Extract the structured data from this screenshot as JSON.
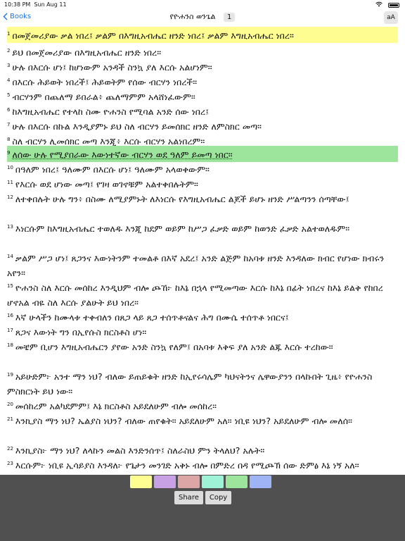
{
  "status_bar": {
    "time": "10:38 PM",
    "date": "Sun Aug 11",
    "battery_percent": 100
  },
  "nav": {
    "back_label": "Books",
    "title": "የዮሐንስ ወንጌል",
    "chapter": "1",
    "font_button": "aA"
  },
  "colors": {
    "accent": "#1a73e8",
    "highlight_yellow": "#fefd92",
    "highlight_green": "#9de59d"
  },
  "verses": [
    {
      "num": "1",
      "text": "በመጀመሪያው ቃል ነበረ፤ ቃልም በእግዚአብሔር ዘንድ ነበረ፤ ቃልም እግዚአብሔር ነበረ።",
      "highlight": "yellow"
    },
    {
      "num": "2",
      "text": "ይህ በመጀመሪያው በእግዚአብሔር ዘንድ ነበረ።"
    },
    {
      "num": "3",
      "text": "ሁሉ በእርሱ ሆነ፤ ከሆነውም አንዳች ስንኳ ያለ እርሱ አልሆነም።"
    },
    {
      "num": "4",
      "text": "በእርሱ ሕይወት ነበረች፤ ሕይወትም የሰው ብርሃን ነበረች።"
    },
    {
      "num": "5",
      "text": "ብርሃንም በጨለማ ይበራል፥ ጨለማምም አላሸነፈውም።"
    },
    {
      "num": "6",
      "text": "ከእግዚአብሔር የተላከ ስሙ ዮሐንስ የሚባል አንድ ሰው ነበረ፤"
    },
    {
      "num": "7",
      "text": "ሁሉ በእርሱ በኩል እንዲያምኑ ይህ ስለ ብርሃን ይመሰክር ዘንድ ለምስክር መጣ።"
    },
    {
      "num": "8",
      "text": "ስለ ብርሃን ሊመሰክር መጣ እንጂ፥ እርሱ ብርሃን አልነበረም።"
    },
    {
      "num": "9",
      "text": "ለሰው ሁሉ የሚያበራው እውነተኛው ብርሃን ወደ ዓለም ይመጣ ነበር።",
      "highlight": "green"
    },
    {
      "num": "10",
      "text": "በዓለም ነበረ፤ ዓለሙም በእርሱ ሆነ፤ ዓለሙም አላወቀውም።"
    },
    {
      "num": "11",
      "text": "የእርሱ ወደ ሆነው መጣ፤ የገዛ ወገኖቹም አልተቀበሉትም።"
    },
    {
      "num": "12",
      "text": "ለተቀበሉት ሁሉ ግን፥ በስሙ ለሚያምኑት ለእነርሱ የእግዚአብሔር ልጆች ይሆኑ ዘንድ ሥልጣንን ሰጣቸው፤"
    },
    {
      "num": "13",
      "text": "እነርሱም ከእግዚአብሔር ተወለዱ እንጂ ከደም ወይም ከሥጋ ፈቃድ ወይም ከወንድ ፈቃድ አልተወለዱም።"
    },
    {
      "num": "14",
      "text": "ቃልም ሥጋ ሆነ፤ ጸጋንና እውነትንም ተመልቶ በእኛ አደረ፤ አንድ ልጅም ከአባቱ ዘንድ እንዳለው ክብር የሆነው ክብሩን አየን።"
    },
    {
      "num": "15",
      "text": "ዮሐንስ ስለ እርሱ መሰከረ እንዲህም ብሎ ጮኸ፦ ከእኔ በኋላ የሚመጣው እርሱ ከእኔ በፊት ነበረና ከእኔ ይልቅ የከበረ ሆኖአል ብዬ ስለ እርሱ ያልሁት ይህ ነበረ።"
    },
    {
      "num": "16",
      "text": "እኛ ሁላችን ከሙላቱ ተቀብለን በጸጋ ላይ ጸጋ ተሰጥቶናልና ሕግ በሙሴ ተሰጥቶ ነበርና፤"
    },
    {
      "num": "17",
      "text": "ጸጋና እውነት ግን በኢየሱስ ክርስቶስ ሆነ።"
    },
    {
      "num": "18",
      "text": "መቼም ቢሆን እግዚአብሔርን ያየው አንድ ስንኳ የለም፤ በአባቱ እቅፍ ያለ አንድ ልጁ እርሱ ተረከው።"
    },
    {
      "num": "19",
      "text": "አይሁድም፦ አንተ ማን ነህ? ብለው ይጠይቁት ዘንድ ከኢየሩሳሌም ካህናትንና ሌዋውያንን በላኩበት ጊዜ፥ የዮሐንስ ምስክርነት ይህ ነው።"
    },
    {
      "num": "20",
      "text": "መሰከረም አልካደምም፤ እኔ ክርስቶስ አይደለሁም ብሎ መሰከረ።"
    },
    {
      "num": "21",
      "text": "እንኪያስ ማን ነህ? ኤልያስ ነህን? ብለው ጠየቁት። አይደለሁም አለ። ነቢዩ ነህን? አይደለሁም ብሎ መለሰ።"
    },
    {
      "num": "22",
      "text": "እንኪያስ፦ ማን ነህ? ለላኩን መልስ እንድንሰጥ፤ ስለራስህ ምን ትላለህ? አሉት።"
    },
    {
      "num": "23",
      "text": "እርሱም፦ ነቢዩ ኢሳይያስ እንዳለ፦ የጌታን መንገድ አቅኑ ብሎ በምድረ በዳ የሚጮኽ ሰው ድምፅ እኔ ነኝ አለ።"
    }
  ],
  "highlight_colors": [
    {
      "name": "yellow",
      "color": "#fefd92"
    },
    {
      "name": "purple",
      "color": "#c7a1e3"
    },
    {
      "name": "pink",
      "color": "#dca6a6"
    },
    {
      "name": "teal",
      "color": "#9ef2d6"
    },
    {
      "name": "green",
      "color": "#9de59d"
    },
    {
      "name": "blue",
      "color": "#9fb4f5"
    }
  ],
  "actions": {
    "share_label": "Share",
    "copy_label": "Copy"
  }
}
